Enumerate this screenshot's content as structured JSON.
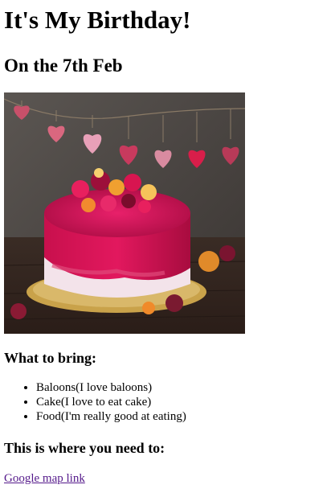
{
  "page": {
    "title": "It's My Birthday!",
    "subtitle": "On the 7th Feb"
  },
  "image": {
    "subject": "birthday-cake-photo"
  },
  "bring": {
    "heading": "What to bring:",
    "items": [
      {
        "label": "Baloons(I love baloons)"
      },
      {
        "label": "Cake(I love to eat cake)"
      },
      {
        "label": "Food(I'm really good at eating)"
      }
    ]
  },
  "location": {
    "heading": "This is where you need to:",
    "link_label": "Google map link",
    "link_color": "#551a8b"
  }
}
